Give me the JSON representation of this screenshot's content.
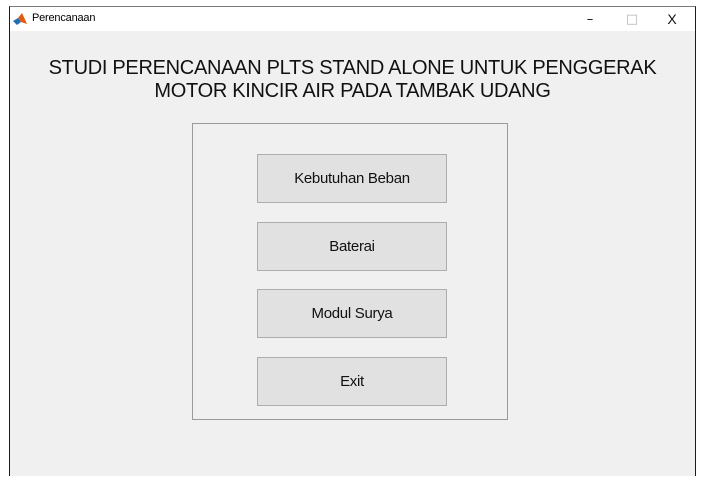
{
  "window": {
    "title": "Perencanaan",
    "minimize_glyph": "–",
    "maximize_glyph": "□",
    "close_glyph": "X"
  },
  "heading": {
    "line1": "STUDI PERENCANAAN PLTS STAND ALONE UNTUK PENGGERAK",
    "line2": "MOTOR KINCIR AIR PADA TAMBAK UDANG"
  },
  "menu": {
    "buttons": [
      {
        "label": "Kebutuhan Beban"
      },
      {
        "label": "Baterai"
      },
      {
        "label": "Modul Surya"
      },
      {
        "label": "Exit"
      }
    ]
  },
  "icons": {
    "app": "matlab-icon"
  },
  "colors": {
    "background": "#f0f0f0",
    "button": "#e1e1e1",
    "button_border": "#adadad",
    "titlebar": "#ffffff"
  }
}
